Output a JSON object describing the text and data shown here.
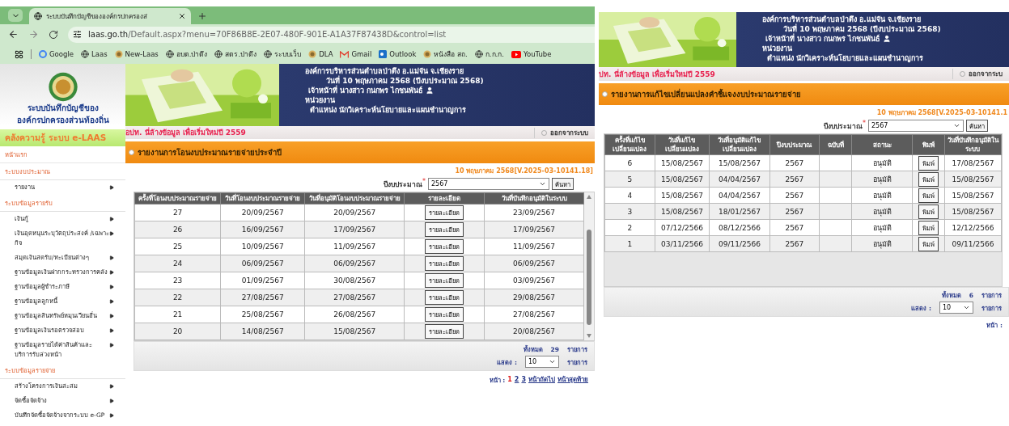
{
  "left": {
    "browser": {
      "tab_title": "ระบบบันทึกบัญชีขององค์กรปกครองส่",
      "url_host": "laas.go.th",
      "url_path": "/Default.aspx?menu=70F86B8E-2E07-480F-901E-A1A37F87438D&control=list",
      "bookmarks": [
        {
          "label": "Google"
        },
        {
          "label": "Laas"
        },
        {
          "label": "New-Laas"
        },
        {
          "label": "อบต.ป่าตึง"
        },
        {
          "label": "สตร.ป่าตึง"
        },
        {
          "label": "ระบบเว็บ"
        },
        {
          "label": "DLA"
        },
        {
          "label": "Gmail"
        },
        {
          "label": "Outlook"
        },
        {
          "label": "หนังสือ สถ."
        },
        {
          "label": "ก.ก.ก."
        },
        {
          "label": "YouTube"
        }
      ]
    },
    "header": {
      "logo_line1": "ระบบบันทึกบัญชีของ",
      "logo_line2": "องค์กรปกครองส่วนท้องถิ่น",
      "org": "องค์การบริหารส่วนตำบลป่าตึง อ.แม่จัน จ.เชียงราย",
      "date_line": "วันที่ 10 พฤษภาคม 2568  (ปีงบประมาณ 2568)",
      "officer": "เจ้าหน้าที่ นางสาว กนกพร ไกชนพันธ์",
      "unit": "หน่วยงาน",
      "position": "ตำแหน่ง นักวิเคราะห์นโยบายและแผนชำนาญการ"
    },
    "notice": "อปท. นี่ล้างข้อมูล เพื่อเริ่มใหม่ปี 2559",
    "logout": "ออกจากระบบ",
    "sidebar": {
      "banner": "คลังความรู้ ระบบ e-LAAS",
      "items": [
        {
          "kind": "link",
          "label": "หน้าแรก"
        },
        {
          "kind": "section",
          "label": "ระบบงบประมาณ"
        },
        {
          "kind": "item",
          "label": "รายงาน"
        },
        {
          "kind": "section",
          "label": "ระบบข้อมูลรายรับ"
        },
        {
          "kind": "item",
          "label": "เงินกู้"
        },
        {
          "kind": "item",
          "label": "เงินอุดหนุนระบุวัตถุประสงค์ /เฉพาะกิจ"
        },
        {
          "kind": "item",
          "label": "สมุดเงินสดรับ/ทะเบียนต่างๆ"
        },
        {
          "kind": "item",
          "label": "ฐานข้อมูลเงินฝากกระทรวงการคลัง"
        },
        {
          "kind": "item",
          "label": "ฐานข้อมูลผู้ชำระภาษี"
        },
        {
          "kind": "item",
          "label": "ฐานข้อมูลลูกหนี้"
        },
        {
          "kind": "item",
          "label": "ฐานข้อมูลสินทรัพย์หมุนเวียนอื่น"
        },
        {
          "kind": "item",
          "label": "ฐานข้อมูลเงินรอตรวจสอบ"
        },
        {
          "kind": "item",
          "label": "ฐานข้อมูลรายได้ค่าสินค้าและบริการรับล่วงหน้า"
        },
        {
          "kind": "section",
          "label": "ระบบข้อมูลรายจ่าย"
        },
        {
          "kind": "item",
          "label": "สร้างโครงการเงินสะสม"
        },
        {
          "kind": "item",
          "label": "จัดซื้อจัดจ้าง"
        },
        {
          "kind": "item",
          "label": "บันทึกจัดซื้อจัดจ้างจากระบบ e-GP"
        }
      ]
    },
    "report": {
      "title": "รายงานการโอนงบประมาณรายจ่ายประจำปี",
      "version": "10 พฤษภาคม 2568[V.2025-03-10141.18]",
      "year_label": "ปีงบประมาณ",
      "required_mark": "*",
      "year_value": "2567",
      "search_button": "ค้นหา",
      "columns": [
        "ครั้งที่โอนงบประมาณรายจ่าย",
        "วันที่โอนงบประมาณรายจ่าย",
        "วันที่อนุมัติโอนงบประมาณรายจ่าย",
        "รายละเอียด",
        "วันที่บันทึกอนุมัติในระบบ"
      ],
      "rows": [
        {
          "no": "27",
          "transfer": "20/09/2567",
          "approve": "20/09/2567",
          "button": "รายละเอียด",
          "saved": "23/09/2567"
        },
        {
          "no": "26",
          "transfer": "16/09/2567",
          "approve": "17/09/2567",
          "button": "รายละเอียด",
          "saved": "17/09/2567"
        },
        {
          "no": "25",
          "transfer": "10/09/2567",
          "approve": "11/09/2567",
          "button": "รายละเอียด",
          "saved": "11/09/2567"
        },
        {
          "no": "24",
          "transfer": "06/09/2567",
          "approve": "06/09/2567",
          "button": "รายละเอียด",
          "saved": "06/09/2567"
        },
        {
          "no": "23",
          "transfer": "01/09/2567",
          "approve": "30/08/2567",
          "button": "รายละเอียด",
          "saved": "03/09/2567"
        },
        {
          "no": "22",
          "transfer": "27/08/2567",
          "approve": "27/08/2567",
          "button": "รายละเอียด",
          "saved": "29/08/2567"
        },
        {
          "no": "21",
          "transfer": "25/08/2567",
          "approve": "26/08/2567",
          "button": "รายละเอียด",
          "saved": "27/08/2567"
        },
        {
          "no": "20",
          "transfer": "14/08/2567",
          "approve": "15/08/2567",
          "button": "รายละเอียด",
          "saved": "20/08/2567"
        }
      ],
      "total_label": "ทั้งหมด",
      "total": "29",
      "unit": "รายการ",
      "show_label": "แสดง :",
      "show_value": "10",
      "show_unit": "รายการ",
      "pager": {
        "label": "หน้า :",
        "pages": [
          {
            "label": "1",
            "selected": true
          },
          {
            "label": "2",
            "selected": false
          },
          {
            "label": "3",
            "selected": false
          }
        ],
        "next": "หน้าถัดไป",
        "last": "หน้าสุดท้าย"
      }
    }
  },
  "right": {
    "header": {
      "org": "องค์การบริหารส่วนตำบลป่าตึง อ.แม่จัน จ.เชียงราย",
      "date_line": "วันที่ 10 พฤษภาคม 2568  (ปีงบประมาณ 2568)",
      "officer": "เจ้าหน้าที่ นางสาว กนกพร ไกชนพันธ์",
      "unit": "หน่วยงาน",
      "position": "ตำแหน่ง นักวิเคราะห์นโยบายและแผนชำนาญการ"
    },
    "notice": "ปท. นี่ล้างข้อมูล เพื่อเริ่มใหม่ปี 2559",
    "logout": "ออกจากระบ",
    "report": {
      "title": "รายงานการแก้ไขเปลี่ยนแปลงคำชี้แจงงบประมาณรายจ่าย",
      "version": "10 พฤษภาคม 2568[V.2025-03-10141.1",
      "year_label": "ปีงบประมาณ",
      "required_mark": "*",
      "year_value": "2567",
      "search_button": "ค้นหา",
      "columns": [
        "ครั้งที่แก้ไขเปลี่ยนแปลง",
        "วันที่แก้ไขเปลี่ยนแปลง",
        "วันที่อนุมัติแก้ไขเปลี่ยนแปลง",
        "ปีงบประมาณ",
        "ฉบับที่",
        "สถานะ",
        "พิมพ์",
        "วันที่บันทึกอนุมัติในระบบ"
      ],
      "rows": [
        {
          "no": "6",
          "changed": "15/08/2567",
          "approve": "15/08/2567",
          "year": "2567",
          "status": "อนุมัติ",
          "button": "พิมพ์",
          "saved": "17/08/2567"
        },
        {
          "no": "5",
          "changed": "15/08/2567",
          "approve": "04/04/2567",
          "year": "2567",
          "status": "อนุมัติ",
          "button": "พิมพ์",
          "saved": "15/08/2567"
        },
        {
          "no": "4",
          "changed": "15/08/2567",
          "approve": "04/04/2567",
          "year": "2567",
          "status": "อนุมัติ",
          "button": "พิมพ์",
          "saved": "15/08/2567"
        },
        {
          "no": "3",
          "changed": "15/08/2567",
          "approve": "18/01/2567",
          "year": "2567",
          "status": "อนุมัติ",
          "button": "พิมพ์",
          "saved": "15/08/2567"
        },
        {
          "no": "2",
          "changed": "07/12/2566",
          "approve": "08/12/2566",
          "year": "2567",
          "status": "อนุมัติ",
          "button": "พิมพ์",
          "saved": "12/12/2566"
        },
        {
          "no": "1",
          "changed": "03/11/2566",
          "approve": "09/11/2566",
          "year": "2567",
          "status": "อนุมัติ",
          "button": "พิมพ์",
          "saved": "09/11/2566"
        }
      ],
      "total_label": "ทั้งหมด",
      "total": "6",
      "unit": "รายการ",
      "show_label": "แสดง :",
      "show_value": "10",
      "show_unit": "รายการ",
      "pager_label": "หน้า :"
    }
  }
}
